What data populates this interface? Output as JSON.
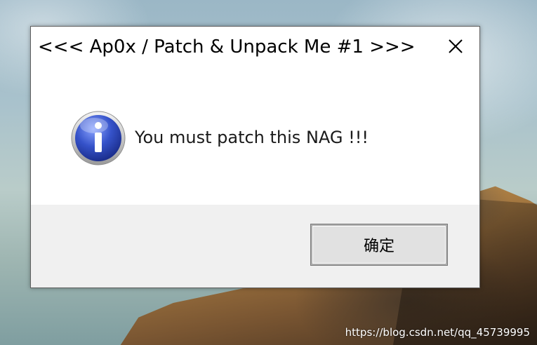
{
  "dialog": {
    "title": "<<< Ap0x / Patch & Unpack Me #1 >>>",
    "message": "You must patch this NAG !!!",
    "icon": "information-icon",
    "ok_label": "确定",
    "close_icon": "close-icon"
  },
  "desktop": {
    "watermark": "https://blog.csdn.net/qq_45739995"
  }
}
